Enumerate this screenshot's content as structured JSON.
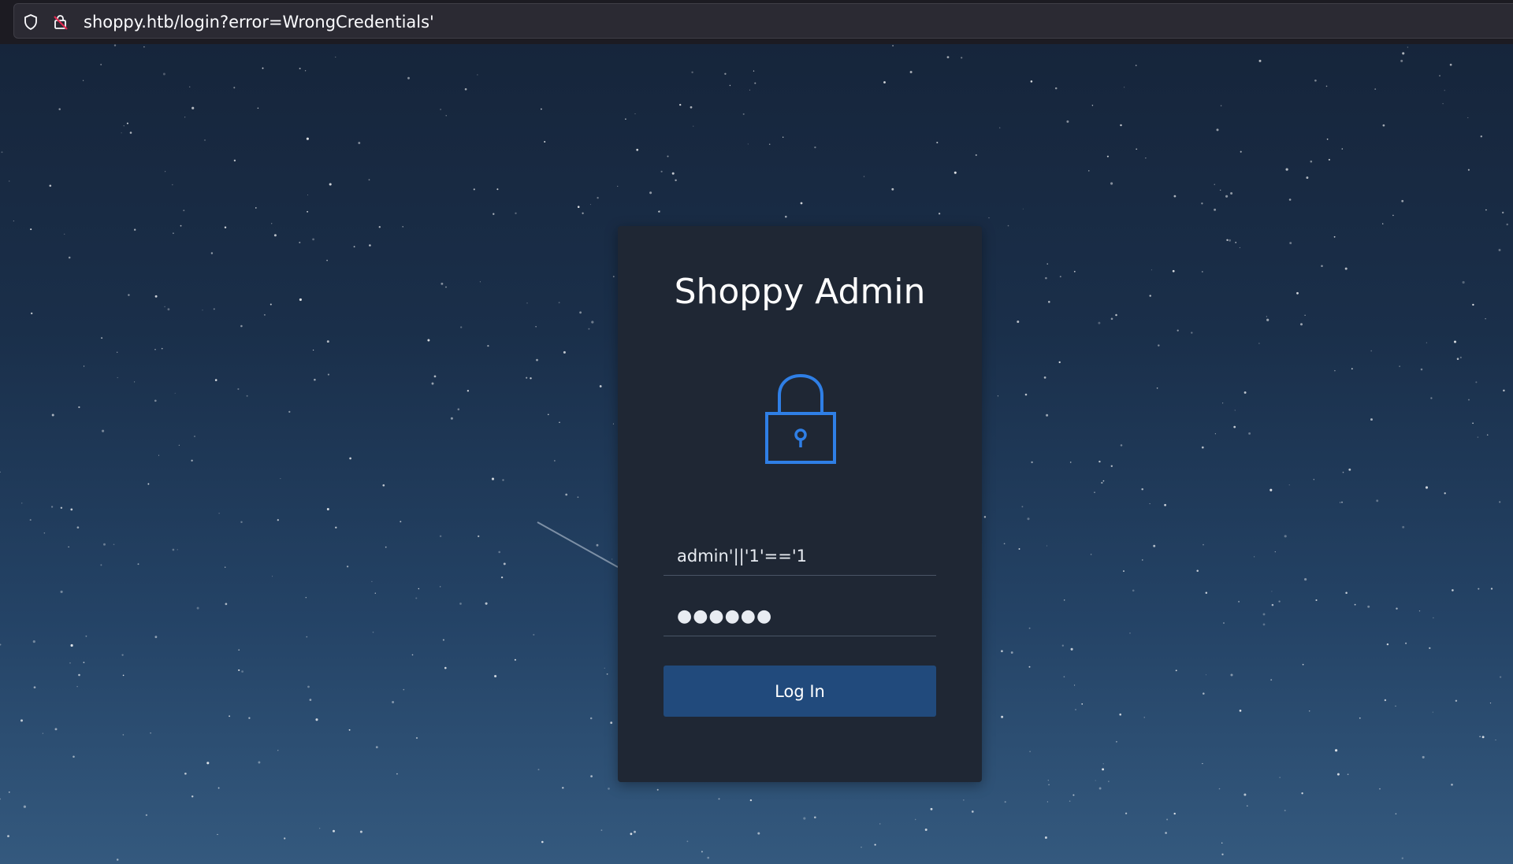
{
  "browser": {
    "url": "shoppy.htb/login?error=WrongCredentials'"
  },
  "login": {
    "title": "Shoppy Admin",
    "username_value": "admin'||'1'=='1",
    "password_masked": "●●●●●●",
    "button_label": "Log In"
  },
  "icons": {
    "tracking": "shield-icon",
    "security": "lock-insecure-icon",
    "card": "padlock-icon"
  },
  "colors": {
    "accent": "#2f7fe6",
    "button": "#214a7c",
    "card": "#1f2734"
  }
}
